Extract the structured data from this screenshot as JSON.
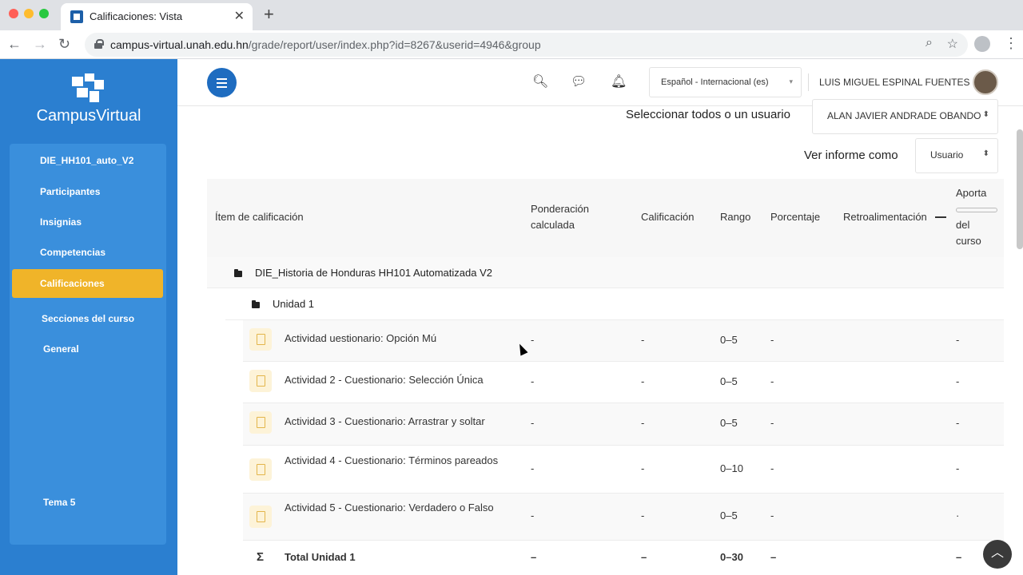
{
  "browser": {
    "tab_title": "Calificaciones: Vista",
    "url_host": "campus-virtual.unah.edu.hn",
    "url_path": "/grade/report/user/index.php?id=8267&userid=4946&group"
  },
  "sidebar": {
    "logo_text": "CampusVirtual",
    "items": [
      {
        "label": "DIE_HH101_auto_V2"
      },
      {
        "label": "Participantes"
      },
      {
        "label": "Insignias"
      },
      {
        "label": "Competencias"
      },
      {
        "label": "Calificaciones"
      },
      {
        "label": "Secciones del curso"
      },
      {
        "label": "General"
      },
      {
        "label": "Tema 5"
      }
    ]
  },
  "header": {
    "language": "Español - Internacional (es)",
    "user_name": "LUIS MIGUEL ESPINAL FUENTES"
  },
  "controls": {
    "select_user_label": "Seleccionar todos o un usuario",
    "select_user_value": "ALAN JAVIER ANDRADE OBANDO",
    "view_as_label": "Ver informe como",
    "view_as_value": "Usuario"
  },
  "table": {
    "headers": {
      "item": "Ítem de calificación",
      "ponderacion": [
        "Ponderación",
        "calculada"
      ],
      "calificacion": "Calificación",
      "rango": "Rango",
      "porcentaje": "Porcentaje",
      "retro": "Retroalimentación",
      "aporta": [
        "Aporta",
        "del",
        "curso"
      ]
    },
    "course_category": "DIE_Historia de Honduras HH101 Automatizada V2",
    "unit_category": "Unidad 1",
    "rows": [
      {
        "name": "Actividad        uestionario: Opción Mú",
        "ponderacion": "-",
        "calificacion": "-",
        "rango": "0–5",
        "porcentaje": "-",
        "aporta": "-"
      },
      {
        "name": "Actividad 2 - Cuestionario: Selección Única",
        "ponderacion": "-",
        "calificacion": "-",
        "rango": "0–5",
        "porcentaje": "-",
        "aporta": "-"
      },
      {
        "name": "Actividad 3 - Cuestionario: Arrastrar y soltar",
        "ponderacion": "-",
        "calificacion": "-",
        "rango": "0–5",
        "porcentaje": "-",
        "aporta": "-"
      },
      {
        "name": "Actividad 4 - Cuestionario: Términos pareados",
        "ponderacion": "-",
        "calificacion": "-",
        "rango": "0–10",
        "porcentaje": "-",
        "aporta": "-"
      },
      {
        "name": "Actividad 5 - Cuestionario: Verdadero o Falso",
        "ponderacion": "-",
        "calificacion": "-",
        "rango": "0–5",
        "porcentaje": "-",
        "aporta": "·"
      }
    ],
    "total": {
      "symbol": "Σ",
      "name": "Total Unidad 1",
      "ponderacion": "–",
      "calificacion": "–",
      "rango": "0–30",
      "porcentaje": "–",
      "aporta": "–"
    }
  }
}
